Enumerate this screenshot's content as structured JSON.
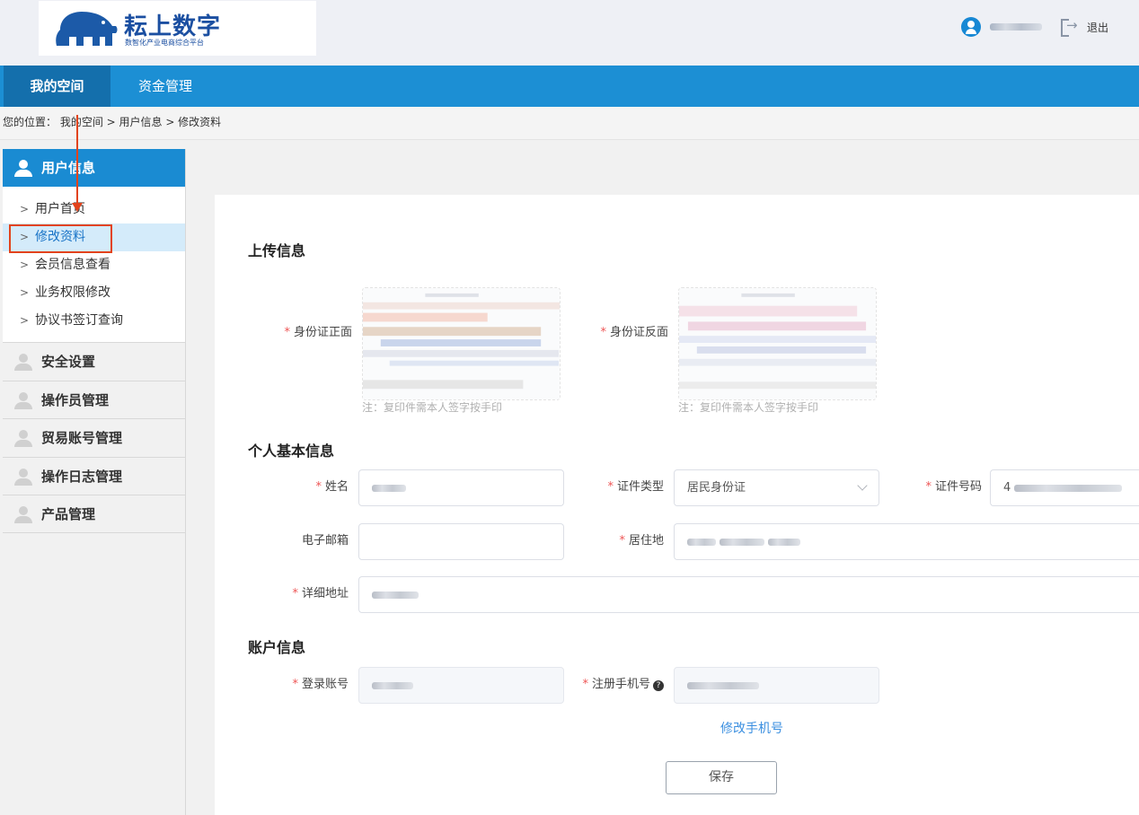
{
  "header": {
    "brand_title": "耘上数字",
    "brand_subtitle": "数智化产业电商综合平台",
    "logout_label": "退出"
  },
  "nav": {
    "items": [
      {
        "label": "我的空间"
      },
      {
        "label": "资金管理"
      }
    ]
  },
  "breadcrumb": {
    "text": "您的位置：  我的空间 > 用户信息 > 修改资料"
  },
  "sidebar": {
    "header": "用户信息",
    "sub_items": [
      {
        "label": "用户首页"
      },
      {
        "label": "修改资料"
      },
      {
        "label": "会员信息查看"
      },
      {
        "label": "业务权限修改"
      },
      {
        "label": "协议书签订查询"
      }
    ],
    "groups": [
      {
        "label": "安全设置"
      },
      {
        "label": "操作员管理"
      },
      {
        "label": "贸易账号管理"
      },
      {
        "label": "操作日志管理"
      },
      {
        "label": "产品管理"
      }
    ]
  },
  "form": {
    "upload_section_title": "上传信息",
    "id_front_label": "身份证正面",
    "id_back_label": "身份证反面",
    "upload_note": "注：复印件需本人签字按手印",
    "basic_section_title": "个人基本信息",
    "name_label": "姓名",
    "id_type_label": "证件类型",
    "id_type_value": "居民身份证",
    "id_number_label": "证件号码",
    "id_number_prefix": "4",
    "email_label": "电子邮箱",
    "residence_label": "居住地",
    "address_label": "详细地址",
    "account_section_title": "账户信息",
    "login_label": "登录账号",
    "phone_label": "注册手机号",
    "help_glyph": "?",
    "change_phone_link": "修改手机号",
    "save_button": "保存"
  }
}
